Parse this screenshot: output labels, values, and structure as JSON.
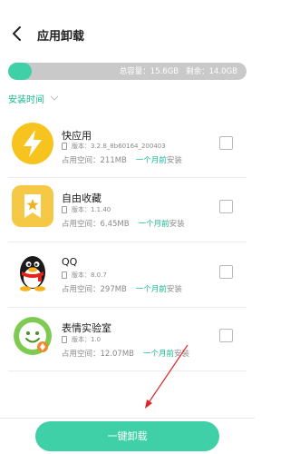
{
  "header": {
    "title": "应用卸载",
    "back_icon": "back-arrow-icon"
  },
  "storage": {
    "total_label": "总容量：15.6GB",
    "remaining_label": "剩余：14.0GB",
    "used_fraction": 0.1,
    "fill_color": "#3fd0a8",
    "track_color": "#c9c9c9"
  },
  "sort": {
    "label": "安装时间"
  },
  "apps": [
    {
      "name": "快应用",
      "version": "版本：3.2.8_8b60164_200403",
      "size": "占用空间：211MB",
      "time": "一个月前",
      "suffix": "安装",
      "icon": "quick-app-icon"
    },
    {
      "name": "自由收藏",
      "version": "版本：1.1.40",
      "size": "占用空间：6.45MB",
      "time": "一个月前",
      "suffix": "安装",
      "icon": "favorites-icon"
    },
    {
      "name": "QQ",
      "version": "版本：8.0.7",
      "size": "占用空间：297MB",
      "time": "一个月前",
      "suffix": "安装",
      "icon": "qq-penguin-icon"
    },
    {
      "name": "表情实验室",
      "version": "版本：1.0",
      "size": "占用空间：12.07MB",
      "time": "一个月前",
      "suffix": "安装",
      "icon": "emoji-lab-icon"
    }
  ],
  "footer": {
    "uninstall_label": "一键卸载"
  },
  "colors": {
    "accent": "#3fd0a8",
    "accent_text": "#17b892",
    "annotation": "#e0242a"
  }
}
